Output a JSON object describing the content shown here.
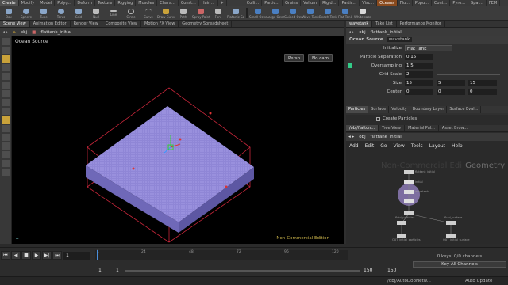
{
  "shelf_tabs": [
    "Create",
    "Modify",
    "Model",
    "Polyg...",
    "Deform",
    "Texture",
    "Rigging",
    "Muscles",
    "Chara...",
    "Const...",
    "Hair ...",
    "+",
    "Colli...",
    "Partic...",
    "Grains",
    "Vellum",
    "Rigid...",
    "Partic...",
    "Visc...",
    "Oceans",
    "Flu...",
    "Popu...",
    "Cont...",
    "Pyro...",
    "Spar...",
    "FEM"
  ],
  "shelf_tools_left": [
    "Box",
    "Sphere",
    "Tube",
    "Torus",
    "Grid",
    "Null",
    "Line",
    "Circle",
    "Curve",
    "Draw Curve",
    "Path",
    "Spray Paint",
    "Font",
    "Platonic Solids"
  ],
  "shelf_tools_right": [
    "Small Ocean",
    "Large Ocean",
    "Guided Ocean Layer",
    "Wave Tank",
    "Beach Tank",
    "Flat Tank",
    "Whitewater"
  ],
  "left_tabs": [
    "Scene View",
    "Animation Editor",
    "Render View",
    "Composite View",
    "Motion FX View",
    "Geometry Spreadsheet"
  ],
  "left_path": [
    "obj",
    "flattank_initial"
  ],
  "viewport": {
    "title": "Ocean Source",
    "persp": "Persp",
    "cam": "No cam",
    "watermark": "Non-Commercial Edition"
  },
  "right_tabs": [
    "wavetank",
    "Take List",
    "Performance Monitor"
  ],
  "right_path": [
    "obj",
    "flattank_initial"
  ],
  "params": {
    "node_type": "Ocean Source",
    "node_name": "wavetank",
    "initialize_label": "Initialize",
    "initialize_value": "Flat Tank",
    "rows": [
      {
        "label": "Particle Separation",
        "value": "0.15"
      },
      {
        "label": "Oversampling",
        "value": "1.5"
      },
      {
        "label": "Grid Scale",
        "value": "2"
      },
      {
        "label": "Size",
        "value": "15"
      },
      {
        "label": "Center",
        "value": "0"
      }
    ],
    "size_extra": [
      "5",
      "15"
    ],
    "center_extra": [
      "0",
      "0"
    ],
    "subtabs": [
      "Particles",
      "Surface",
      "Velocity",
      "Boundary Layer",
      "Surface Eval..."
    ],
    "create_particles": "Create Particles"
  },
  "net_tabs": [
    "/obj/flatton...",
    "Tree View",
    "Material Pal...",
    "Asset Brow..."
  ],
  "net_path": [
    "obj",
    "flattank_initial"
  ],
  "net_menu": [
    "Add",
    "Edit",
    "Go",
    "View",
    "Tools",
    "Layout",
    "Help"
  ],
  "net_watermark": "Non-Commercial Edi",
  "net_geometry": "Geometry",
  "net_nodes": [
    "flattank_initial",
    "initial",
    "wavetank",
    "fluid_particles",
    "fluid_surface",
    "OUT_initial_particles",
    "OUT_initial_surface"
  ],
  "timeline": {
    "frame": "1",
    "ticks": [
      "1",
      "24",
      "48",
      "72",
      "96",
      "120"
    ],
    "range_start": "1",
    "range_start2": "1",
    "range_end": "150",
    "range_end2": "150",
    "keys": "0 keys, 0/0 channels",
    "key_all": "Key All Channels"
  },
  "status": {
    "path": "/obj/AutoDopNetw...",
    "update": "Auto Update"
  }
}
